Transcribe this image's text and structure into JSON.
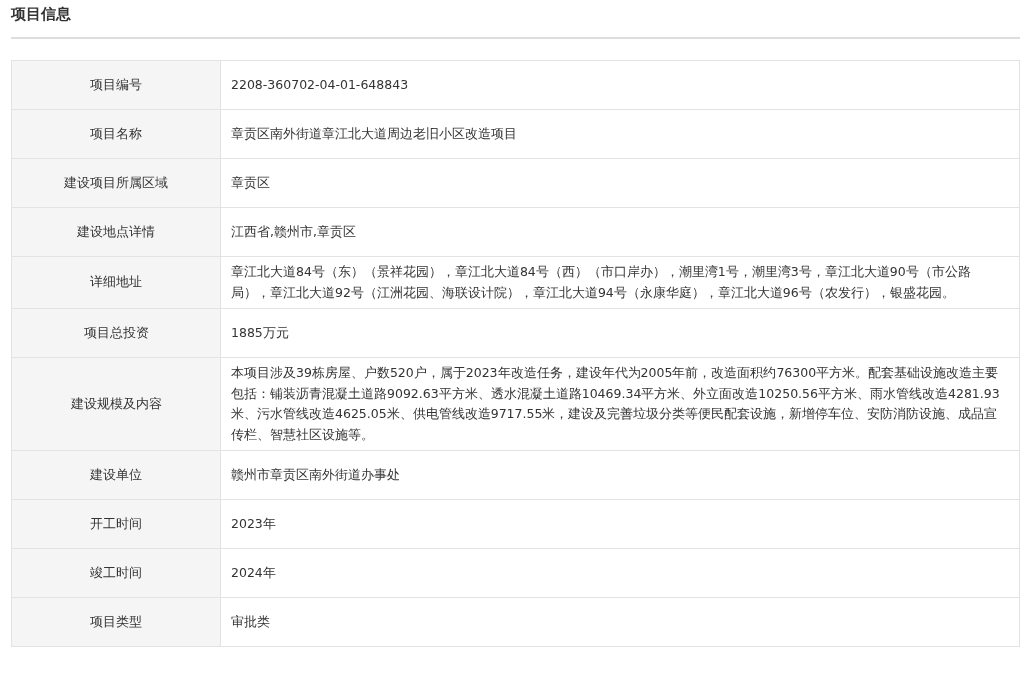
{
  "title": "项目信息",
  "rows": [
    {
      "label": "项目编号",
      "value": "2208-360702-04-01-648843"
    },
    {
      "label": "项目名称",
      "value": "章贡区南外街道章江北大道周边老旧小区改造项目"
    },
    {
      "label": "建设项目所属区域",
      "value": "章贡区"
    },
    {
      "label": "建设地点详情",
      "value": "江西省,赣州市,章贡区"
    },
    {
      "label": "详细地址",
      "value": "章江北大道84号（东）（景祥花园），章江北大道84号（西）（市口岸办），潮里湾1号，潮里湾3号，章江北大道90号（市公路局），章江北大道92号（江洲花园、海联设计院），章江北大道94号（永康华庭），章江北大道96号（农发行），银盛花园。"
    },
    {
      "label": "项目总投资",
      "value": "1885万元"
    },
    {
      "label": "建设规模及内容",
      "value": "本项目涉及39栋房屋、户数520户，属于2023年改造任务，建设年代为2005年前，改造面积约76300平方米。配套基础设施改造主要包括：铺装沥青混凝土道路9092.63平方米、透水混凝土道路10469.34平方米、外立面改造10250.56平方米、雨水管线改造4281.93米、污水管线改造4625.05米、供电管线改造9717.55米，建设及完善垃圾分类等便民配套设施，新增停车位、安防消防设施、成品宣传栏、智慧社区设施等。"
    },
    {
      "label": "建设单位",
      "value": "赣州市章贡区南外街道办事处"
    },
    {
      "label": "开工时间",
      "value": "2023年"
    },
    {
      "label": "竣工时间",
      "value": "2024年"
    },
    {
      "label": "项目类型",
      "value": "审批类"
    }
  ]
}
